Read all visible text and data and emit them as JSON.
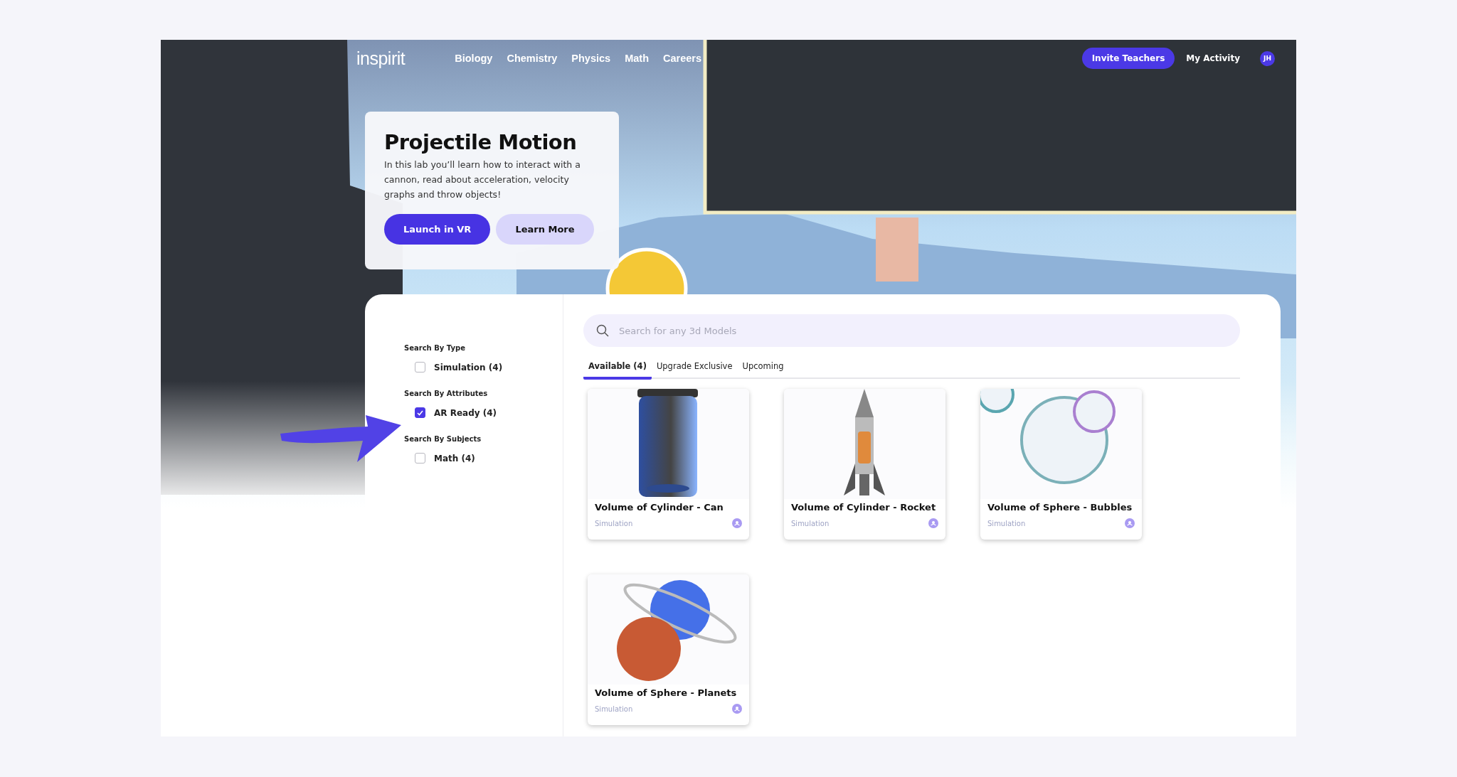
{
  "header": {
    "logo": "inspirit",
    "nav": [
      {
        "label": "Biology"
      },
      {
        "label": "Chemistry"
      },
      {
        "label": "Physics"
      },
      {
        "label": "Math"
      },
      {
        "label": "Careers"
      }
    ],
    "invite_button": "Invite Teachers",
    "my_activity": "My Activity",
    "avatar": "JH"
  },
  "hero": {
    "title": "Projectile Motion",
    "description": "In this lab you’ll learn how to interact with a cannon, read about acceleration, velocity graphs and throw objects!",
    "buttons": [
      {
        "label": "Launch in VR",
        "kind": "primary"
      },
      {
        "label": "Learn More",
        "kind": "secondary"
      }
    ]
  },
  "filters": [
    {
      "heading": "Search By Type",
      "options": [
        {
          "label": "Simulation (4)",
          "checked": false
        }
      ]
    },
    {
      "heading": "Search By Attributes",
      "options": [
        {
          "label": "AR Ready (4)",
          "checked": true
        }
      ]
    },
    {
      "heading": "Search By Subjects",
      "options": [
        {
          "label": "Math (4)",
          "checked": false
        }
      ]
    }
  ],
  "search": {
    "placeholder": "Search for any 3d Models"
  },
  "tabs": [
    {
      "label": "Available (4)",
      "selected": true
    },
    {
      "label": "Upgrade Exclusive",
      "selected": false
    },
    {
      "label": "Upcoming",
      "selected": false
    }
  ],
  "models": [
    {
      "title": "Volume of Cylinder - Can",
      "type": "Simulation"
    },
    {
      "title": "Volume of Cylinder - Rocket",
      "type": "Simulation"
    },
    {
      "title": "Volume of Sphere - Bubbles",
      "type": "Simulation"
    },
    {
      "title": "Volume of Sphere - Planets",
      "type": "Simulation"
    }
  ]
}
